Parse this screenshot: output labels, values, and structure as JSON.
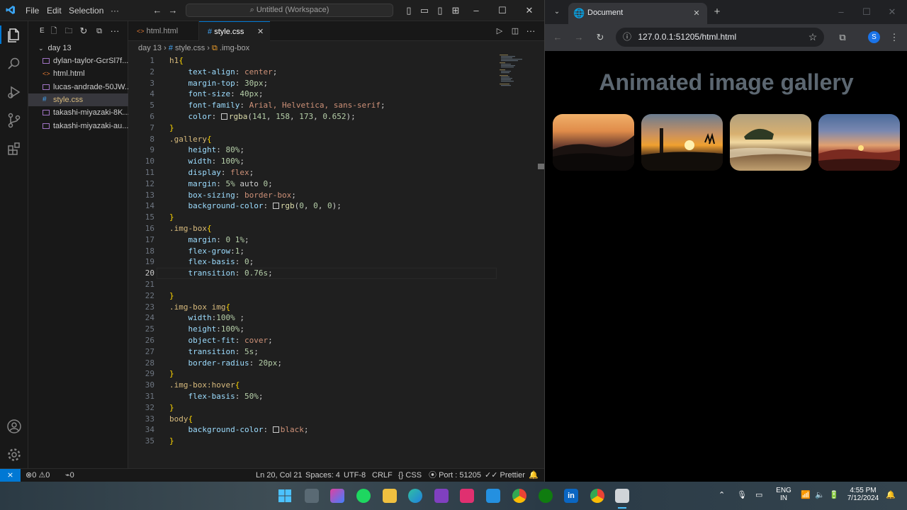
{
  "vscode": {
    "menu": [
      "File",
      "Edit",
      "Selection"
    ],
    "more": "···",
    "search_placeholder": "Untitled (Workspace)",
    "explorer_header": "E",
    "folder": "day 13",
    "files": [
      "dylan-taylor-GcrSl7f...",
      "html.html",
      "lucas-andrade-50JW...",
      "style.css",
      "takashi-miyazaki-8K...",
      "takashi-miyazaki-au..."
    ],
    "tabs": [
      {
        "label": "html.html"
      },
      {
        "label": "style.css"
      }
    ],
    "breadcrumb": {
      "folder": "day 13",
      "file": "style.css",
      "symbol": ".img-box"
    },
    "code_lines": [
      "h1{",
      "    text-align: center;",
      "    margin-top: 30px;",
      "    font-size: 40px;",
      "    font-family: Arial, Helvetica, sans-serif;",
      "    color: rgba(141, 158, 173, 0.652);",
      "}",
      ".gallery{",
      "    height: 80%;",
      "    width: 100%;",
      "    display: flex;",
      "    margin: 5% auto 0;",
      "    box-sizing: border-box;",
      "    background-color: rgb(0, 0, 0);",
      "}",
      ".img-box{",
      "    margin: 0 1%;",
      "    flex-grow:1;",
      "    flex-basis: 0;",
      "    transition: 0.76s;",
      "",
      "}",
      ".img-box img{",
      "    width:100% ;",
      "    height:100%;",
      "    object-fit: cover;",
      "    transition: 5s;",
      "    border-radius: 20px;",
      "}",
      ".img-box:hover{",
      "    flex-basis: 50%;",
      "}",
      "body{",
      "    background-color: black;",
      "}"
    ],
    "current_line": 20,
    "status": {
      "errors": "0",
      "warnings": "0",
      "ports": "0",
      "position": "Ln 20, Col 21",
      "spaces": "Spaces: 4",
      "encoding": "UTF-8",
      "eol": "CRLF",
      "language": "CSS",
      "port": "Port : 51205",
      "prettier": "Prettier"
    }
  },
  "chrome": {
    "tab_title": "Document",
    "url": "127.0.0.1:51205/html.html",
    "profile": "S",
    "page": {
      "title": "Animated image gallery"
    }
  },
  "taskbar": {
    "lang1": "ENG",
    "lang2": "IN",
    "time": "4:55 PM",
    "date": "7/12/2024"
  }
}
